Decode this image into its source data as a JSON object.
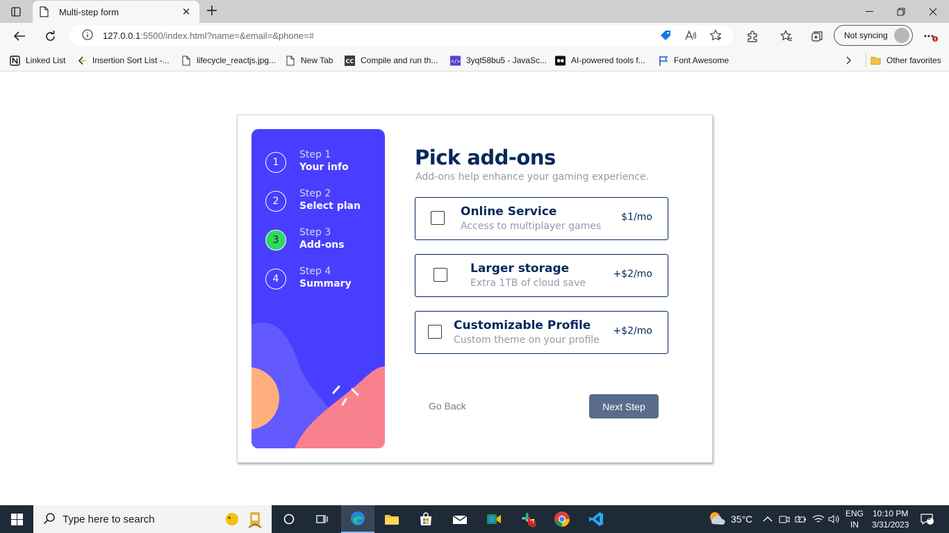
{
  "browser": {
    "tab_title": "Multi-step form",
    "url_host": "127.0.0.1",
    "url_path": ":5500/index.html?name=&email=&phone=#",
    "sync_label": "Not syncing"
  },
  "bookmarks": [
    {
      "label": "Linked List",
      "icon": "notion-icon"
    },
    {
      "label": "Insertion Sort List -...",
      "icon": "leetcode-icon"
    },
    {
      "label": "lifecycle_reactjs.jpg...",
      "icon": "file-icon"
    },
    {
      "label": "New Tab",
      "icon": "file-icon"
    },
    {
      "label": "Compile and run th...",
      "icon": "cc-icon"
    },
    {
      "label": "3yqt58bu5 - JavaSc...",
      "icon": "code-icon"
    },
    {
      "label": "AI-powered tools f...",
      "icon": "futurepedia-icon"
    },
    {
      "label": "Font Awesome",
      "icon": "flag-icon"
    },
    {
      "label": "Other favorites",
      "icon": "folder-icon"
    }
  ],
  "form": {
    "steps": [
      {
        "number": "1",
        "label": "Step 1",
        "name": "Your info",
        "active": false
      },
      {
        "number": "2",
        "label": "Step 2",
        "name": "Select plan",
        "active": false
      },
      {
        "number": "3",
        "label": "Step 3",
        "name": "Add-ons",
        "active": true
      },
      {
        "number": "4",
        "label": "Step 4",
        "name": "Summary",
        "active": false
      }
    ],
    "title": "Pick add-ons",
    "subtitle": "Add-ons help enhance your gaming experience.",
    "addons": [
      {
        "name": "Online Service",
        "desc": "Access to multiplayer games",
        "price": "$1/mo",
        "checked": false
      },
      {
        "name": "Larger storage",
        "desc": "Extra 1TB of cloud save",
        "price": "+$2/mo",
        "checked": false
      },
      {
        "name": "Customizable Profile",
        "desc": "Custom theme on your profile",
        "price": "+$2/mo",
        "checked": false
      }
    ],
    "back_label": "Go Back",
    "next_label": "Next Step"
  },
  "taskbar": {
    "search_placeholder": "Type here to search",
    "weather": "35°C",
    "lang_top": "ENG",
    "lang_bottom": "IN",
    "time": "10:10 PM",
    "date": "3/31/2023",
    "notifications": "3",
    "slack_badge": "7"
  },
  "colors": {
    "sidebar": "#483eff",
    "active_step": "#2fd85a",
    "marine_blue": "#022959",
    "next_button": "#596c8a"
  }
}
